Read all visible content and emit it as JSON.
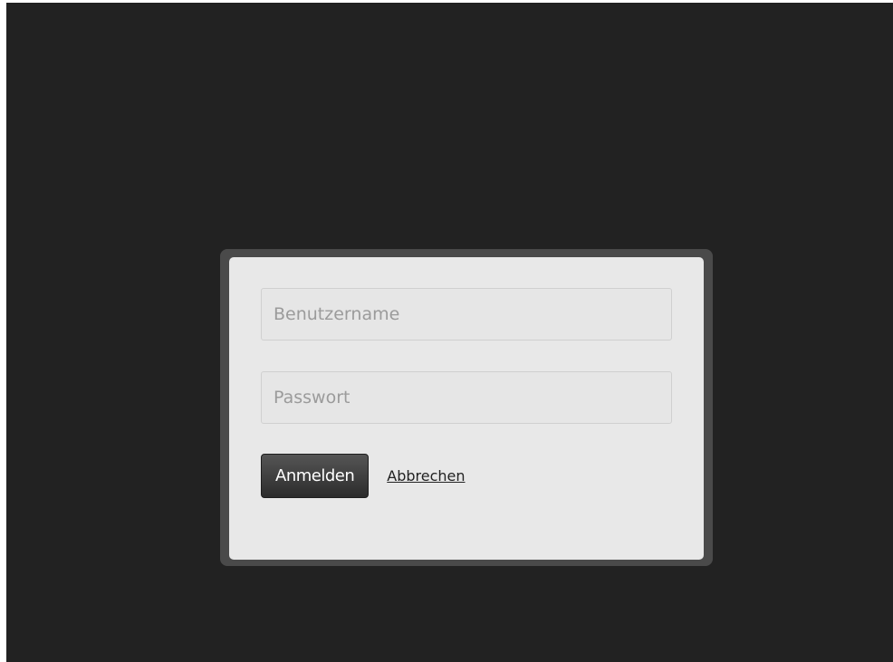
{
  "login_form": {
    "username_placeholder": "Benutzername",
    "password_placeholder": "Passwort",
    "submit_label": "Anmelden",
    "cancel_label": "Abbrechen"
  },
  "colors": {
    "backdrop": "#222222",
    "dialog": "#e8e8e8",
    "button": "#3a3a3a"
  }
}
